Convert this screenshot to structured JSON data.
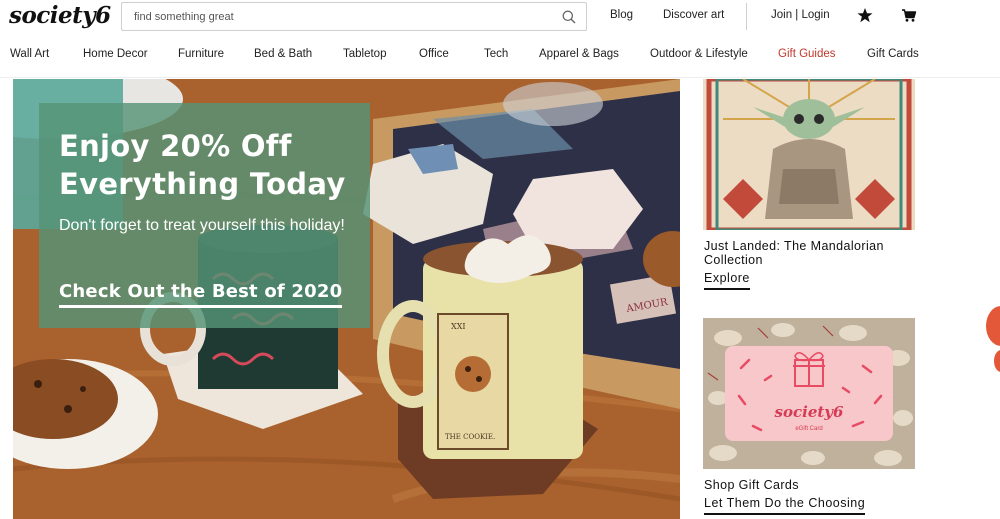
{
  "header": {
    "logo": "society6",
    "search_placeholder": "find something great",
    "links": {
      "blog": "Blog",
      "discover": "Discover art",
      "account": "Join | Login"
    },
    "icons": {
      "search": "search-icon",
      "wishlist": "star-icon",
      "cart": "cart-icon"
    }
  },
  "nav": {
    "items": [
      "Wall Art",
      "Home Decor",
      "Furniture",
      "Bed & Bath",
      "Tabletop",
      "Office",
      "Tech",
      "Apparel & Bags",
      "Outdoor & Lifestyle",
      "Gift Guides",
      "Gift Cards"
    ],
    "highlight_color": "#c0392b"
  },
  "hero": {
    "title": "Enjoy 20% Off Everything Today",
    "subtitle": "Don't forget to treat yourself this holiday!",
    "cta": "Check Out the Best of 2020",
    "mug_card_text": "THE COOKIE.",
    "mug_card_numeral": "XXI",
    "coaster_text": "AMOUR",
    "panel_color": "#569476"
  },
  "cards": [
    {
      "title": "Just Landed: The Mandalorian Collection",
      "link": "Explore"
    },
    {
      "title": "Shop Gift Cards",
      "link": "Let Them Do the Choosing",
      "giftcard_brand": "society6",
      "giftcard_label": "eGift Card"
    }
  ]
}
